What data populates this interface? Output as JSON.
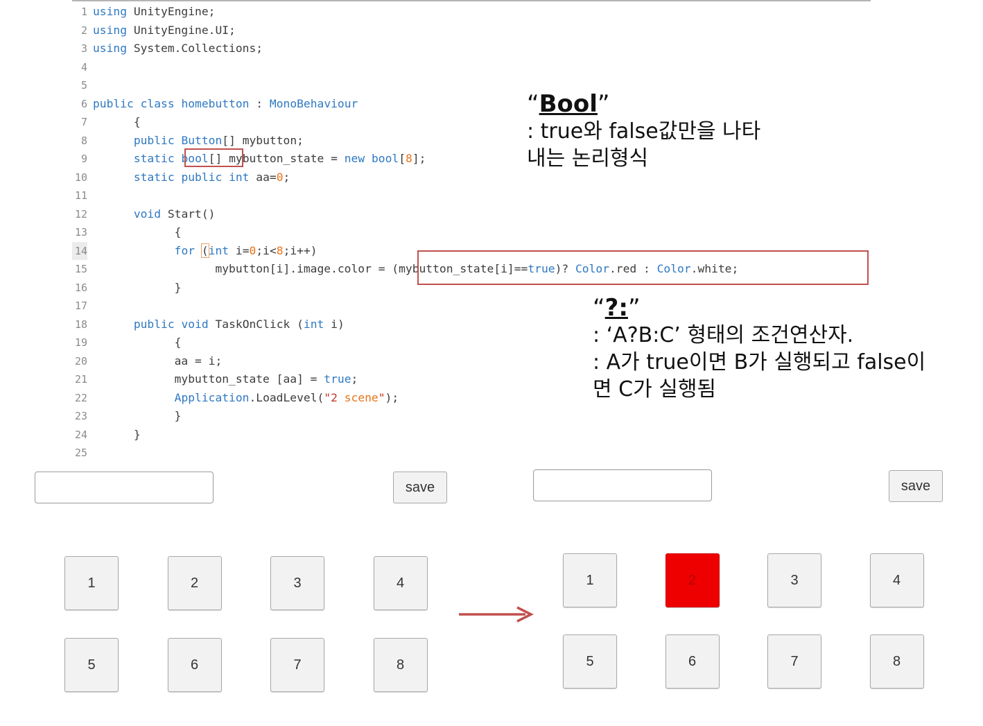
{
  "code": {
    "lines": [
      {
        "n": "1",
        "html": "<span class=\"kw\">using</span> UnityEngine;"
      },
      {
        "n": "2",
        "html": "<span class=\"kw\">using</span> UnityEngine.UI;"
      },
      {
        "n": "3",
        "html": "<span class=\"kw\">using</span> System.Collections;"
      },
      {
        "n": "4",
        "html": ""
      },
      {
        "n": "5",
        "html": ""
      },
      {
        "n": "6",
        "html": "<span class=\"kw\">public class</span> <span class=\"kw\">homebutton</span> : <span class=\"kw\">MonoBehaviour</span>"
      },
      {
        "n": "7",
        "html": "      {"
      },
      {
        "n": "8",
        "html": "      <span class=\"kw\">public</span> <span class=\"kw\">Button</span>[] mybutton;"
      },
      {
        "n": "9",
        "html": "      <span class=\"kw\">static</span> <span class=\"kw\">bool</span>[] mybutton_state = <span class=\"kw\">new</span> <span class=\"kw\">bool</span>[<span class=\"nm\">8</span>];"
      },
      {
        "n": "10",
        "html": "      <span class=\"kw\">static public</span> <span class=\"kw\">int</span> aa=<span class=\"nm\">0</span>;"
      },
      {
        "n": "11",
        "html": ""
      },
      {
        "n": "12",
        "html": "      <span class=\"kw\">void</span> Start()"
      },
      {
        "n": "13",
        "html": "            {"
      },
      {
        "n": "14",
        "html": "            <span class=\"kw\">for</span> <span class=\"bracket-box\">(</span><span class=\"kw\">int</span> i=<span class=\"nm\">0</span>;i&lt;<span class=\"nm\">8</span>;i++)",
        "active": true
      },
      {
        "n": "15",
        "html": "                  mybutton[i].image.color = (mybutton_state[i]==<span class=\"kw\">true</span>)? <span class=\"kw\">Color</span>.red : <span class=\"kw\">Color</span>.white;"
      },
      {
        "n": "16",
        "html": "            }"
      },
      {
        "n": "17",
        "html": ""
      },
      {
        "n": "18",
        "html": "      <span class=\"kw\">public</span> <span class=\"kw\">void</span> TaskOnClick (<span class=\"kw\">int</span> i)"
      },
      {
        "n": "19",
        "html": "            {"
      },
      {
        "n": "20",
        "html": "            aa = i;"
      },
      {
        "n": "21",
        "html": "            mybutton_state [aa] = <span class=\"kw\">true</span>;"
      },
      {
        "n": "22",
        "html": "            <span class=\"kw\">Application</span>.LoadLevel(<span class=\"st\">\"2 </span><span class=\"nm\">scene</span><span class=\"st\">\"</span>);"
      },
      {
        "n": "23",
        "html": "            }"
      },
      {
        "n": "24",
        "html": "      }"
      },
      {
        "n": "25",
        "html": ""
      }
    ]
  },
  "notes": {
    "bool": {
      "title_open": "“",
      "title_word": "Bool",
      "title_close": "”",
      "text": ": true와 false값만을 나타\n내는 논리형식"
    },
    "ternary": {
      "title_open": "“",
      "title_word": "?:",
      "title_close": "”",
      "text": ": ‘A?B:C’ 형태의 조건연산자.\n: A가 true이면 B가 실행되고 false이\n면 C가 실행됨"
    }
  },
  "app_before": {
    "input_value": "",
    "save_label": "save",
    "buttons": [
      "1",
      "2",
      "3",
      "4",
      "5",
      "6",
      "7",
      "8"
    ],
    "selected_index": null
  },
  "app_after": {
    "input_value": "",
    "save_label": "save",
    "buttons": [
      "1",
      "2",
      "3",
      "4",
      "5",
      "6",
      "7",
      "8"
    ],
    "selected_index": 1
  },
  "colors": {
    "highlight_box": "#c0504d",
    "selected_button": "#ee0000",
    "arrow": "#c0504d",
    "keyword": "#2e78c2",
    "number": "#e8731a"
  },
  "icons": {
    "transition": "right-arrow-icon"
  }
}
